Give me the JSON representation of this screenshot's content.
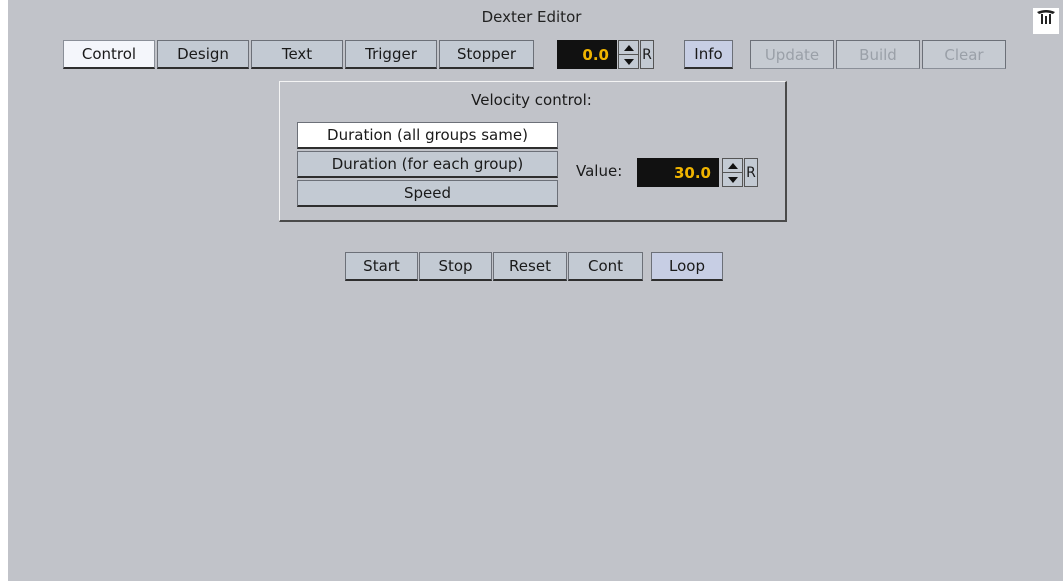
{
  "window": {
    "title": "Dexter Editor"
  },
  "tabs": [
    {
      "label": "Control",
      "active": true
    },
    {
      "label": "Design"
    },
    {
      "label": "Text"
    },
    {
      "label": "Trigger"
    },
    {
      "label": "Stopper"
    }
  ],
  "toolbar": {
    "value": "0.0",
    "reset_label": "R",
    "info_label": "Info",
    "update_label": "Update",
    "build_label": "Build",
    "clear_label": "Clear"
  },
  "velocity": {
    "title": "Velocity control:",
    "options": [
      {
        "label": "Duration (all groups same)",
        "selected": true
      },
      {
        "label": "Duration (for each group)"
      },
      {
        "label": "Speed"
      }
    ],
    "value_label": "Value:",
    "value": "30.0",
    "reset_label": "R"
  },
  "playback": {
    "start_label": "Start",
    "stop_label": "Stop",
    "reset_label": "Reset",
    "cont_label": "Cont",
    "loop_label": "Loop"
  },
  "colors": {
    "panel": "#c1c3c9",
    "button": "#c3cad3",
    "field_bg": "#111111",
    "field_text": "#f0b400"
  },
  "icons": {
    "corner": "pin-icon",
    "spinner_up": "arrow-up-icon",
    "spinner_down": "arrow-down-icon"
  }
}
